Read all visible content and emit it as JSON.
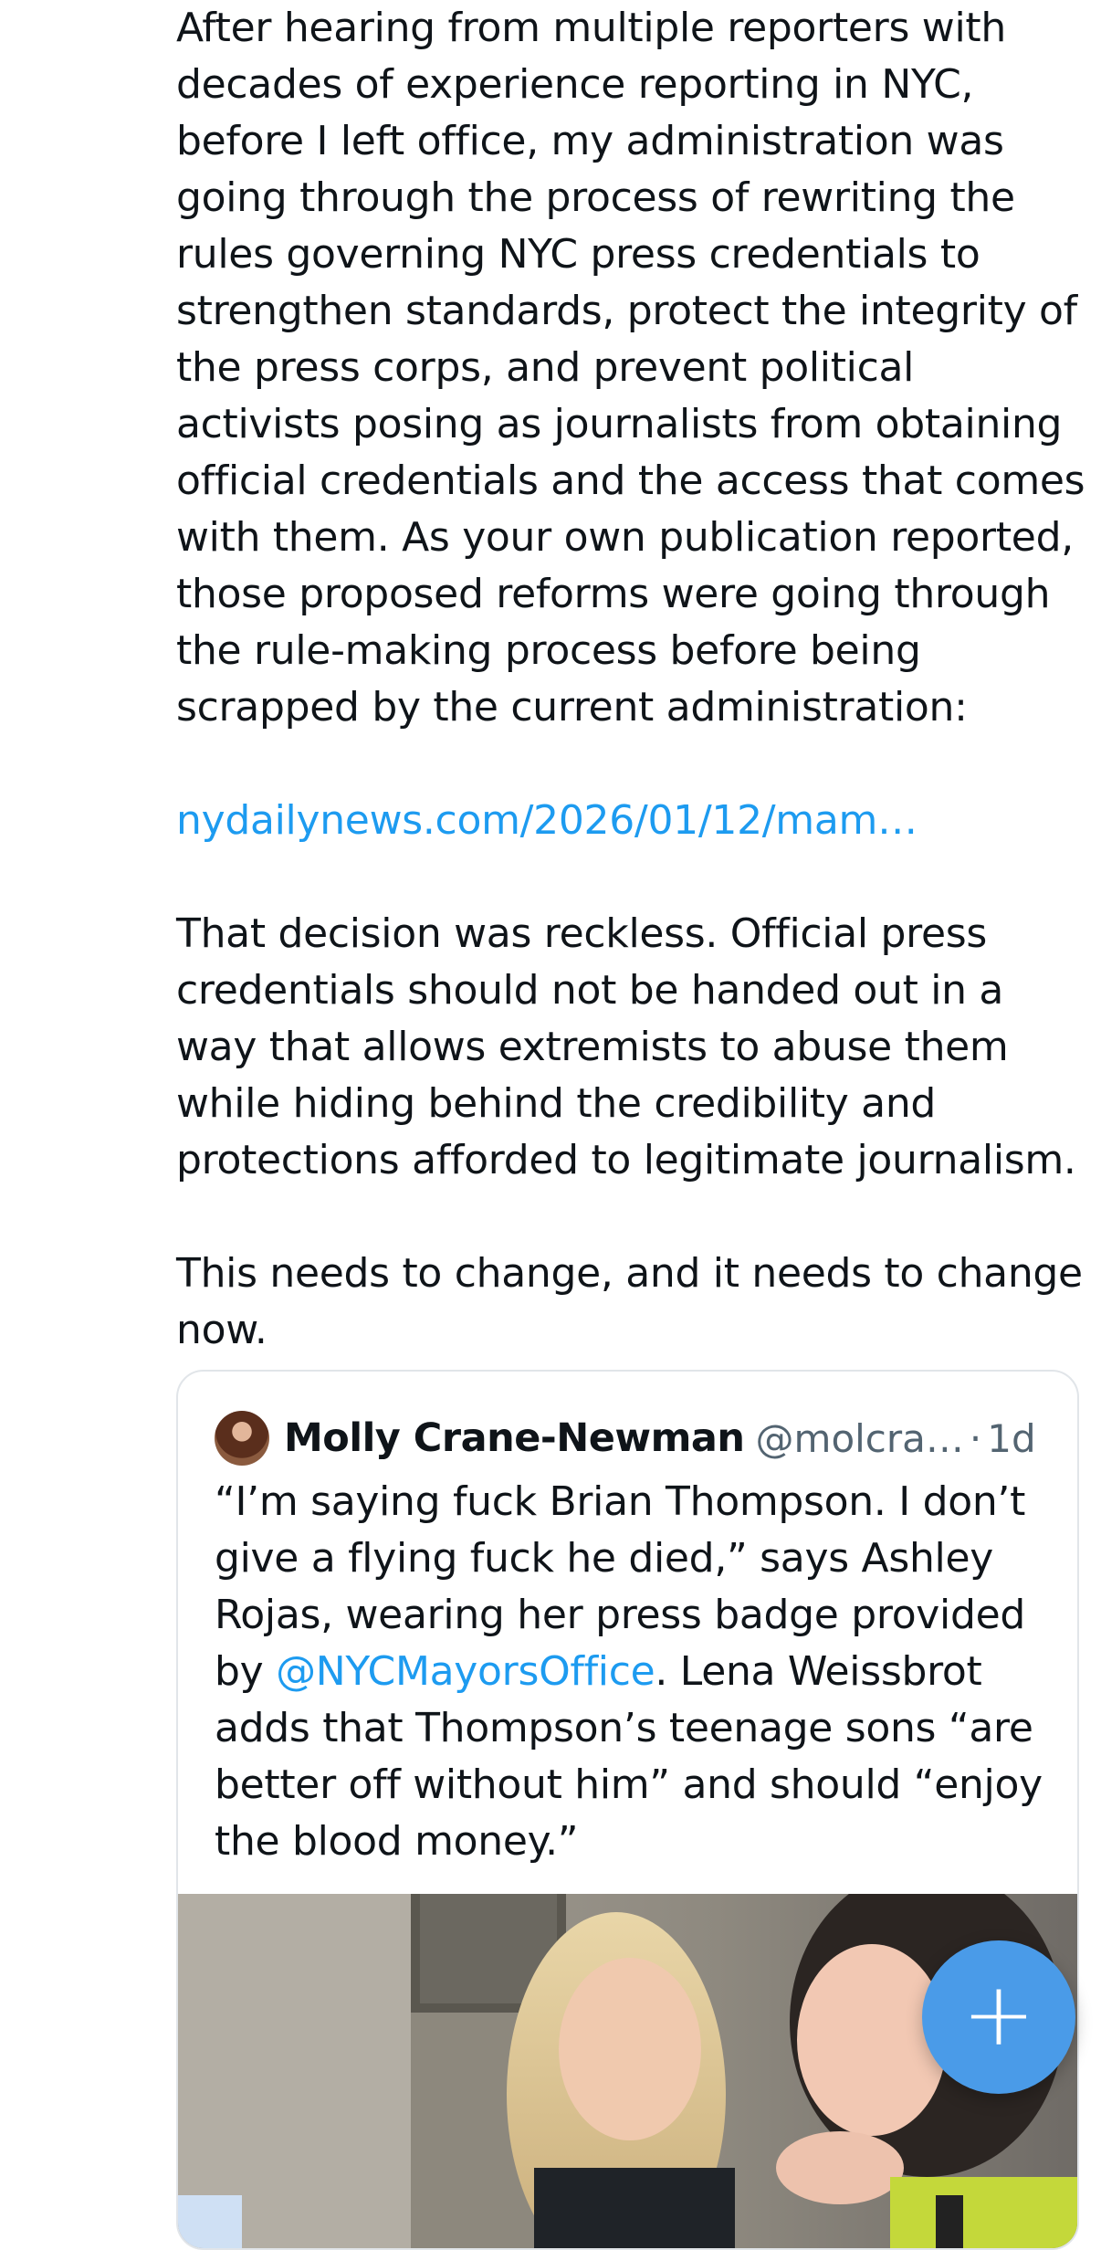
{
  "post": {
    "paragraphs": [
      "After hearing from multiple reporters with decades of experience reporting in NYC, before I left office, my administration was going through the process of rewriting the rules governing NYC press credentials to strengthen standards, protect the integrity of the press corps, and prevent political activists posing as journalists from obtaining official credentials and the access that comes with them. As your own publication reported, those proposed reforms were going through the rule-making process before being scrapped by the current administration:",
      "That decision was reckless. Official press credentials should not be handed out in a way that allows extremists to abuse them while hiding behind the credibility and protections afforded to legitimate journalism.",
      "This needs to change, and it needs to change now."
    ],
    "link_text": "nydailynews.com/2026/01/12/mam…"
  },
  "quote": {
    "name": "Molly Crane-Newman",
    "handle": "@molcra…",
    "separator": "·",
    "time": "1d",
    "text_before_mention": "“I’m saying fuck Brian Thompson. I don’t give a flying fuck he died,” says Ashley Rojas, wearing her press badge provided by ",
    "mention": "@NYCMayorsOffice",
    "text_after_mention": ". Lena Weissbrot adds that Thompson’s teenage sons “are better off without him” and should “enjoy the blood money.”"
  },
  "fab": {
    "icon": "plus-icon",
    "glyph": "+"
  },
  "colors": {
    "text": "#0f1419",
    "link": "#1d9bf0",
    "muted": "#536471",
    "fab": "#4a9be8"
  }
}
